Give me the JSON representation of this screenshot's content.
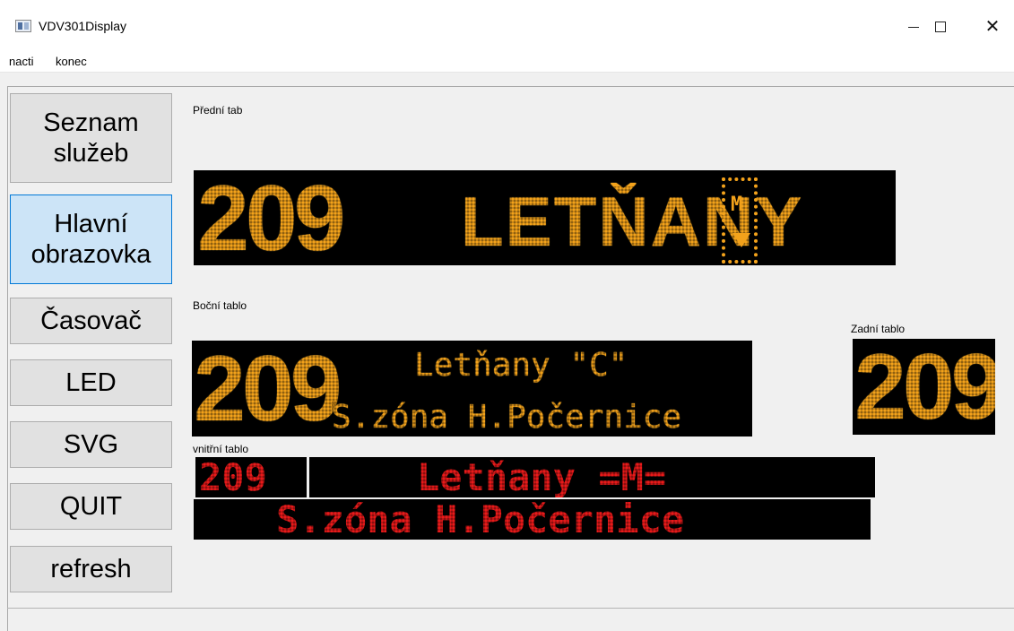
{
  "window": {
    "title": "VDV301Display",
    "controls": {
      "minimize": "minimize-icon",
      "maximize": "maximize-icon",
      "close": "close-icon"
    }
  },
  "menu": {
    "items": [
      "nacti",
      "konec"
    ]
  },
  "sidebar": {
    "buttons": [
      {
        "label": "Seznam\nslužeb"
      },
      {
        "label": "Hlavní\nobrazovka",
        "active": true
      },
      {
        "label": "Časovač"
      },
      {
        "label": "LED"
      },
      {
        "label": "SVG"
      },
      {
        "label": "QUIT"
      },
      {
        "label": "refresh"
      }
    ]
  },
  "front_board": {
    "label": "Přední tab",
    "line": "209",
    "destination": "LETŇANY",
    "icon": "metro-icon",
    "color": "#f3a21b"
  },
  "side_board": {
    "label": "Boční tablo",
    "line": "209",
    "destination": "Letňany \"C\"",
    "via": "S.zóna H.Počernice",
    "color": "#f3a21b"
  },
  "rear_board": {
    "label": "Zadní tablo",
    "line": "209",
    "color": "#f3a21b"
  },
  "inner_board": {
    "label": "vnitřní tablo",
    "line": "209",
    "destination": "Letňany =M=",
    "via": "S.zóna H.Počernice",
    "color": "#e81a1a"
  }
}
